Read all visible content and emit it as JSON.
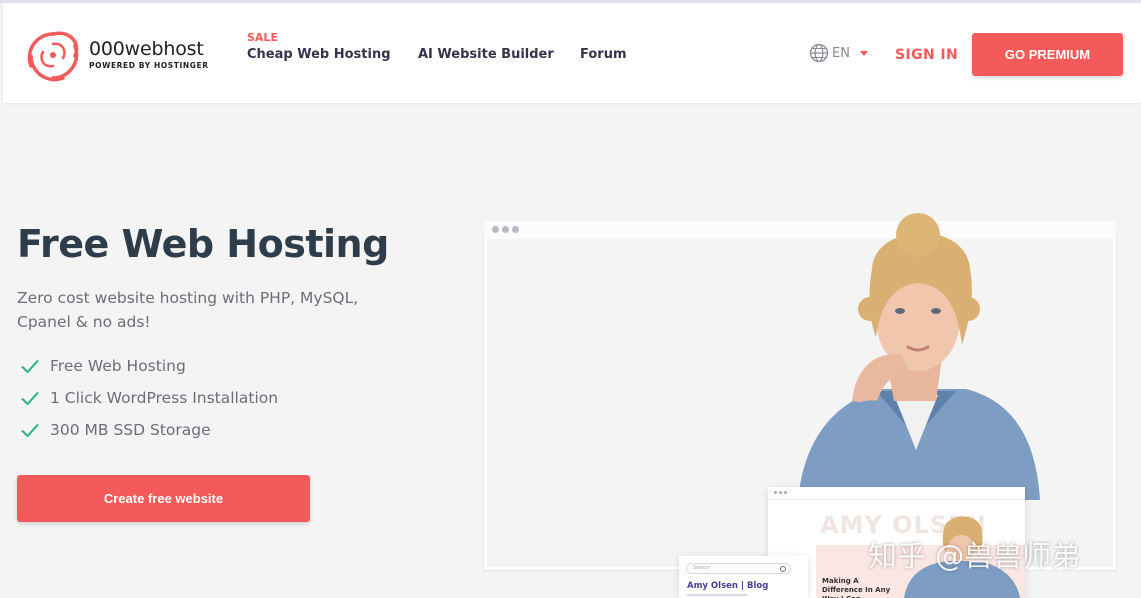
{
  "brand": {
    "name": "000webhost",
    "tagline": "POWERED BY HOSTINGER",
    "accent_color": "#f45a5a",
    "logo_icon": "swirl-logo-icon"
  },
  "nav": {
    "sale_badge": "SALE",
    "links": [
      "Cheap Web Hosting",
      "AI Website Builder",
      "Forum"
    ],
    "language": {
      "icon": "globe-icon",
      "value": "EN"
    },
    "sign_in": "SIGN IN",
    "cta": "GO PREMIUM"
  },
  "hero": {
    "title": "Free Web Hosting",
    "subtitle": "Zero cost website hosting with PHP, MySQL, Cpanel & no ads!",
    "features": [
      "Free Web Hosting",
      "1 Click WordPress Installation",
      "300 MB SSD Storage"
    ],
    "feature_icon": "check-icon",
    "feature_icon_color": "#28b47b",
    "button": "Create free website"
  },
  "preview": {
    "site_card": {
      "big_name": "AMY OLSEN",
      "headline": "Making A Difference In Any Way I Can"
    },
    "blog_card": {
      "search_placeholder": "Search",
      "title": "Amy Olsen | Blog"
    }
  },
  "watermark": "知乎 @兽兽师弟"
}
